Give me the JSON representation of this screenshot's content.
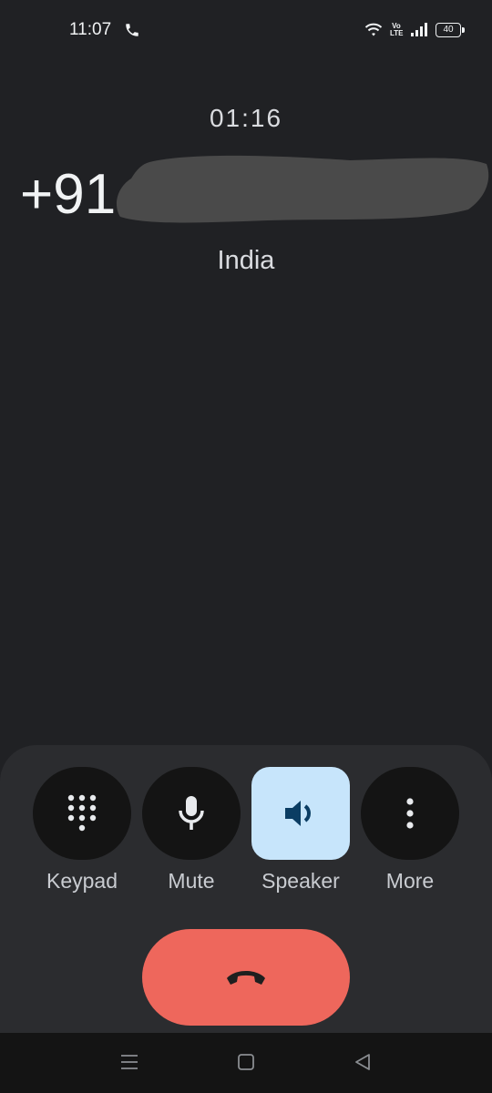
{
  "status_bar": {
    "time": "11:07",
    "network_label": "Vo\nLTE",
    "battery_level": "40"
  },
  "call": {
    "timer": "01:16",
    "number_visible": "+91 9",
    "location": "India"
  },
  "controls": [
    {
      "label": "Keypad",
      "icon": "dialpad-icon",
      "active": false
    },
    {
      "label": "Mute",
      "icon": "microphone-icon",
      "active": false
    },
    {
      "label": "Speaker",
      "icon": "speaker-icon",
      "active": true
    },
    {
      "label": "More",
      "icon": "more-vertical-icon",
      "active": false
    }
  ],
  "end_call": {
    "icon": "end-call-icon"
  },
  "nav": {
    "items": [
      "menu-icon",
      "home-icon",
      "back-icon"
    ]
  },
  "colors": {
    "background": "#202124",
    "panel": "#2b2c2f",
    "button": "#141414",
    "active_button": "#c7e5fb",
    "end_call": "#ee675c"
  }
}
